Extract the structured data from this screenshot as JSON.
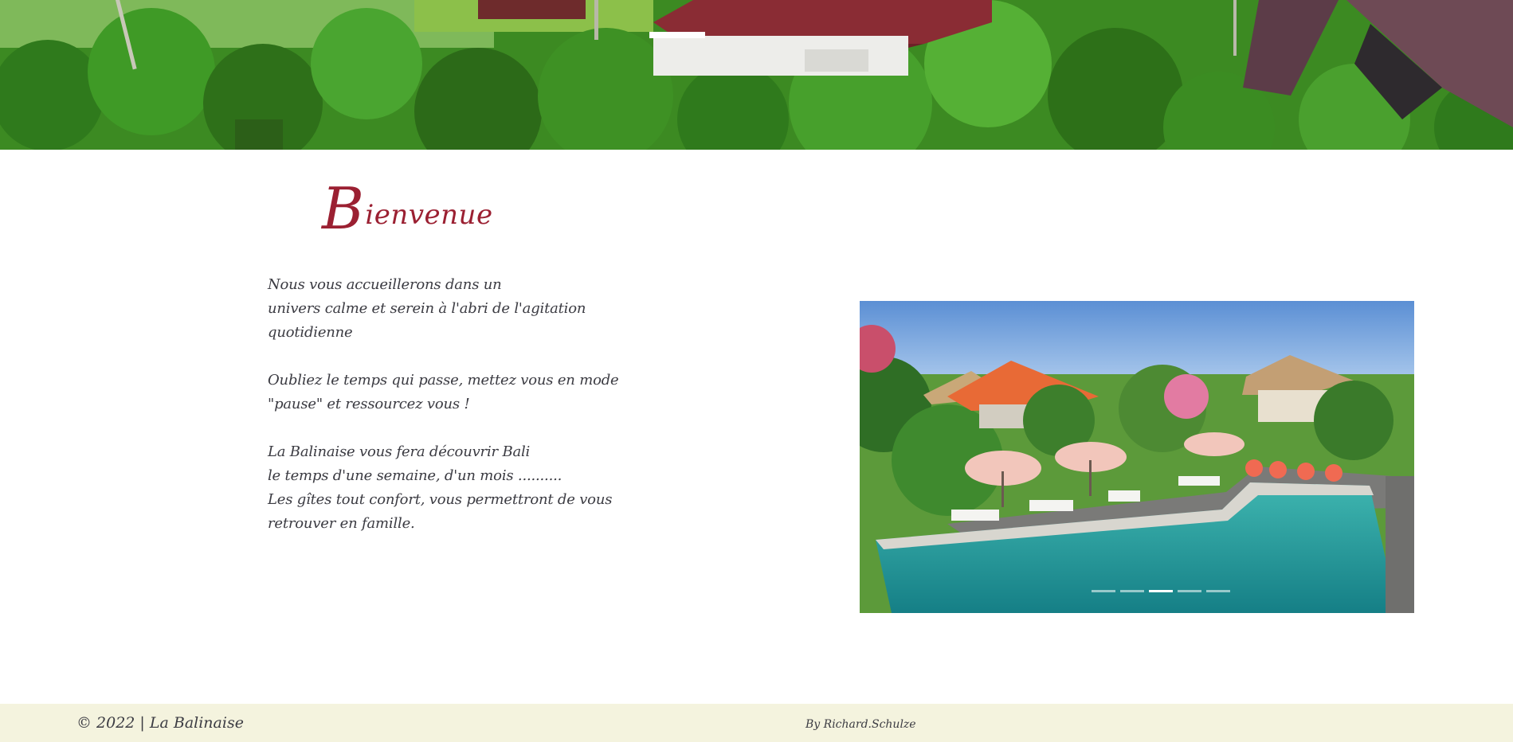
{
  "hero": {
    "image": "tropical-garden-rooftops"
  },
  "welcome": {
    "title_initial": "B",
    "title_rest": "ienvenue",
    "paragraphs": [
      [
        "Nous vous accueillerons dans un",
        "univers calme et serein à l'abri de l'agitation",
        "quotidienne"
      ],
      [
        "Oubliez le temps qui passe, mettez vous en mode",
        "\"pause\" et ressourcez vous !"
      ],
      [
        "La Balinaise vous fera découvrir Bali",
        "le temps d'une semaine, d'un mois ..........",
        "Les gîtes tout confort, vous permettront de vous",
        "retrouver en famille."
      ]
    ]
  },
  "slider": {
    "image": "villa-pool-garden",
    "slide_count": 5,
    "active_slide": 3
  },
  "footer": {
    "copyright": "© 2022 | La Balinaise",
    "credit": "By Richard.Schulze"
  },
  "colors": {
    "title": "#9b2032",
    "text": "#3b3b42",
    "footer_bg": "#f4f3de"
  }
}
